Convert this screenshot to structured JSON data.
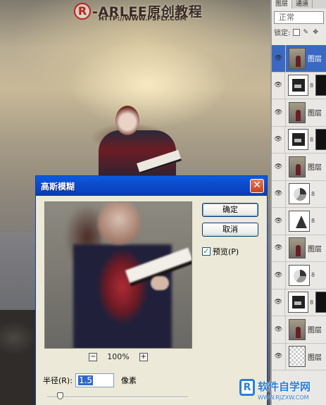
{
  "watermark": {
    "brand": "-ARLEE原创教程",
    "url": "HTTP://WWW.PSFLY.COM",
    "mark": "R"
  },
  "layers_panel": {
    "tabs": [
      "图层",
      "通道"
    ],
    "blend_mode": "正常",
    "lock_label": "锁定:",
    "layers": [
      {
        "name": "图层",
        "thumb": "photo",
        "selected": true,
        "mask": false
      },
      {
        "name": "",
        "thumb": "adj",
        "selected": false,
        "mask": true
      },
      {
        "name": "图层",
        "thumb": "photo",
        "selected": false,
        "mask": false
      },
      {
        "name": "",
        "thumb": "adj",
        "selected": false,
        "mask": true
      },
      {
        "name": "图层",
        "thumb": "photo",
        "selected": false,
        "mask": false
      },
      {
        "name": "",
        "thumb": "pie",
        "selected": false,
        "mask": false
      },
      {
        "name": "",
        "thumb": "tri",
        "selected": false,
        "mask": false
      },
      {
        "name": "图层",
        "thumb": "photo",
        "selected": false,
        "mask": false
      },
      {
        "name": "",
        "thumb": "pie",
        "selected": false,
        "mask": false
      },
      {
        "name": "",
        "thumb": "adj",
        "selected": false,
        "mask": true
      },
      {
        "name": "图层",
        "thumb": "photo",
        "selected": false,
        "mask": false
      },
      {
        "name": "图层",
        "thumb": "transp",
        "selected": false,
        "mask": false
      }
    ]
  },
  "dialog": {
    "title": "高斯模糊",
    "close_glyph": "✕",
    "ok_label": "确定",
    "cancel_label": "取消",
    "preview_checkbox_label": "预览(P)",
    "preview_checked": true,
    "zoom_out": "−",
    "zoom_in": "+",
    "zoom_level": "100%",
    "radius_label": "半径(R):",
    "radius_value": "1.5",
    "radius_unit": "像素"
  },
  "site_watermark": {
    "mark": "R",
    "name": "软件自学网",
    "url": "WWW.RJZXW.COM"
  }
}
